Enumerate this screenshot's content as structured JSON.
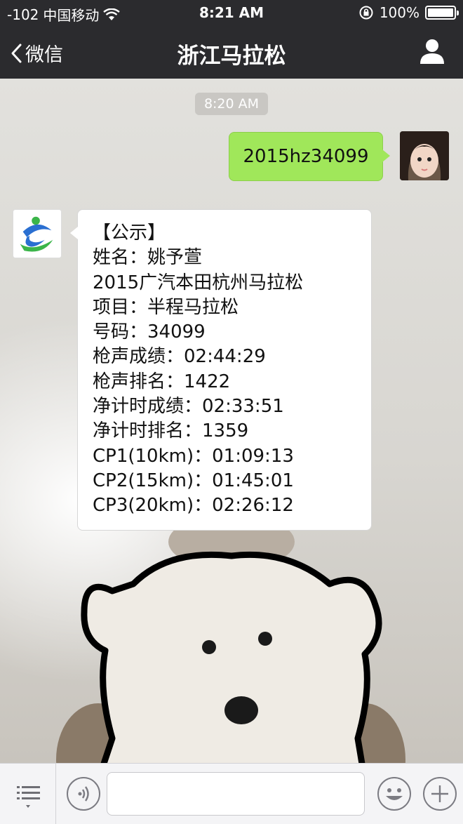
{
  "status_bar": {
    "signal": "-102",
    "carrier": "中国移动",
    "time": "8:21 AM",
    "battery_percent": "100%",
    "battery_level": 1.0
  },
  "nav": {
    "back_label": "微信",
    "title": "浙江马拉松"
  },
  "chat": {
    "timestamp": "8:20 AM",
    "sent_message": "2015hz34099",
    "received_lines": [
      "【公示】",
      "姓名：姚予萱",
      "2015广汽本田杭州马拉松",
      "项目：半程马拉松",
      "号码：34099",
      "枪声成绩：02:44:29",
      "枪声排名：1422",
      "净计时成绩：02:33:51",
      "净计时排名：1359",
      "CP1(10km)：01:09:13",
      "CP2(15km)：01:45:01",
      "CP3(20km)：02:26:12"
    ]
  },
  "toolbar": {
    "input_value": "",
    "icons": [
      "menu-icon",
      "voice-icon",
      "emoji-icon",
      "plus-icon"
    ]
  },
  "colors": {
    "bar_bg": "#2b2b2e",
    "sent_bubble": "#a0e75a",
    "received_bubble": "#ffffff",
    "logo_blue": "#2a6fd1",
    "logo_green": "#3bb54a"
  }
}
